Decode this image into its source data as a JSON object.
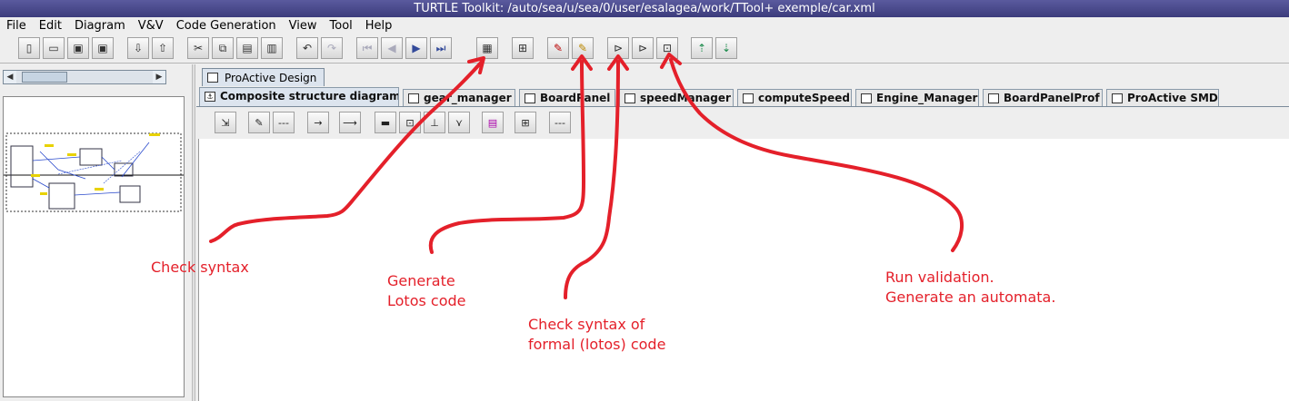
{
  "window": {
    "title": "TURTLE Toolkit: /auto/sea/u/sea/0/user/esalagea/work/TTool+ exemple/car.xml"
  },
  "menu": [
    "File",
    "Edit",
    "Diagram",
    "V&V",
    "Code Generation",
    "View",
    "Tool",
    "Help"
  ],
  "main_toolbar_icons": [
    "new-file-icon",
    "open-folder-icon",
    "save-icon",
    "save-as-icon",
    "import-icon",
    "export-icon",
    "cut-icon",
    "copy-icon",
    "paste-icon",
    "delete-icon",
    "undo-icon",
    "redo-icon",
    "first-icon",
    "previous-icon",
    "next-icon",
    "last-icon",
    "check-syntax-icon",
    "analysis-icon",
    "generate-lotos-icon",
    "generate-code-icon",
    "check-formal-syntax-icon",
    "run-validation-icon",
    "generate-automata-icon",
    "upload-icon",
    "download-icon"
  ],
  "outer_tab": {
    "label": "ProActive Design"
  },
  "diagram_tabs": [
    "Composite structure diagram",
    "gear_manager",
    "BoardPanel",
    "speedManager",
    "computeSpeed",
    "Engine_Manager",
    "BoardPanelProf",
    "ProActive SMD"
  ],
  "diagram_toolbar": {
    "separator_label": "---"
  },
  "annotations": {
    "check_syntax": "Check syntax",
    "generate_lotos_line1": "Generate",
    "generate_lotos_line2": "Lotos code",
    "formal_syntax_line1": "Check syntax of",
    "formal_syntax_line2": "formal (lotos) code",
    "validation_line1": "Run validation.",
    "validation_line2": "Generate an automata."
  },
  "colors": {
    "annotation": "#e4202a",
    "titlebar": "#4a4a8e",
    "tab_active": "#dce4ee"
  }
}
